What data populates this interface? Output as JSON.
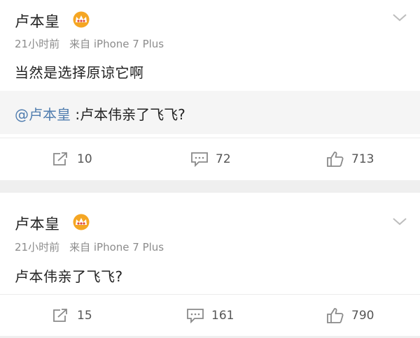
{
  "posts": [
    {
      "author": "卢本皇",
      "time": "21小时前",
      "source": "来自 iPhone 7 Plus",
      "text": "当然是选择原谅它啊",
      "quote": {
        "mention": "@卢本皇",
        "text": " :卢本伟亲了飞飞?"
      },
      "actions": {
        "reposts": "10",
        "comments": "72",
        "likes": "713"
      }
    },
    {
      "author": "卢本皇",
      "time": "21小时前",
      "source": "来自 iPhone 7 Plus",
      "text": "卢本伟亲了飞飞?",
      "actions": {
        "reposts": "15",
        "comments": "161",
        "likes": "790"
      }
    }
  ],
  "icons": {
    "vip_badge": "crown-icon",
    "menu": "chevron-down-icon",
    "repost": "repost-icon",
    "comment": "comment-icon",
    "like": "thumbs-up-icon"
  },
  "colors": {
    "mention": "#507daf",
    "badge": "#f5a623",
    "meta": "#8c8c8c"
  }
}
